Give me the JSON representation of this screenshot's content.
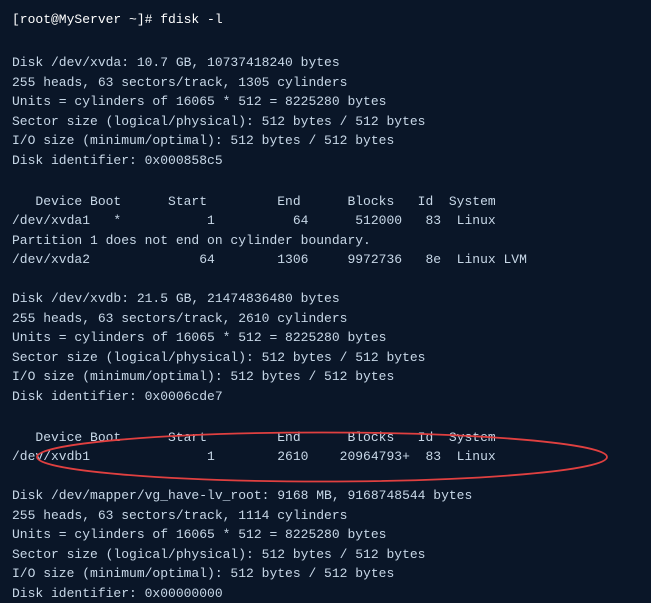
{
  "terminal": {
    "prompt": "[root@MyServer ~]# fdisk -l",
    "disk1": {
      "header": "Disk /dev/xvda: 10.7 GB, 10737418240 bytes",
      "line1": "255 heads, 63 sectors/track, 1305 cylinders",
      "line2": "Units = cylinders of 16065 * 512 = 8225280 bytes",
      "line3": "Sector size (logical/physical): 512 bytes / 512 bytes",
      "line4": "I/O size (minimum/optimal): 512 bytes / 512 bytes",
      "line5": "Disk identifier: 0x000858c5"
    },
    "table1": {
      "header": "   Device Boot      Start         End      Blocks   Id  System",
      "row1": "/dev/xvda1   *           1          64      512000   83  Linux",
      "note": "Partition 1 does not end on cylinder boundary.",
      "row2": "/dev/xvda2              64        1306     9972736   8e  Linux LVM"
    },
    "disk2": {
      "header": "Disk /dev/xvdb: 21.5 GB, 21474836480 bytes",
      "line1": "255 heads, 63 sectors/track, 2610 cylinders",
      "line2": "Units = cylinders of 16065 * 512 = 8225280 bytes",
      "line3": "Sector size (logical/physical): 512 bytes / 512 bytes",
      "line4": "I/O size (minimum/optimal): 512 bytes / 512 bytes",
      "line5": "Disk identifier: 0x0006cde7"
    },
    "table2": {
      "header": "   Device Boot      Start         End      Blocks   Id  System",
      "row1": "/dev/xvdb1               1        2610    20964793+  83  Linux"
    },
    "disk3": {
      "header": "Disk /dev/mapper/vg_have-lv_root: 9168 MB, 9168748544 bytes",
      "line1": "255 heads, 63 sectors/track, 1114 cylinders",
      "line2": "Units = cylinders of 16065 * 512 = 8225280 bytes",
      "line3": "Sector size (logical/physical): 512 bytes / 512 bytes",
      "line4": "I/O size (minimum/optimal): 512 bytes / 512 bytes",
      "line5": "Disk identifier: 0x00000000"
    }
  }
}
